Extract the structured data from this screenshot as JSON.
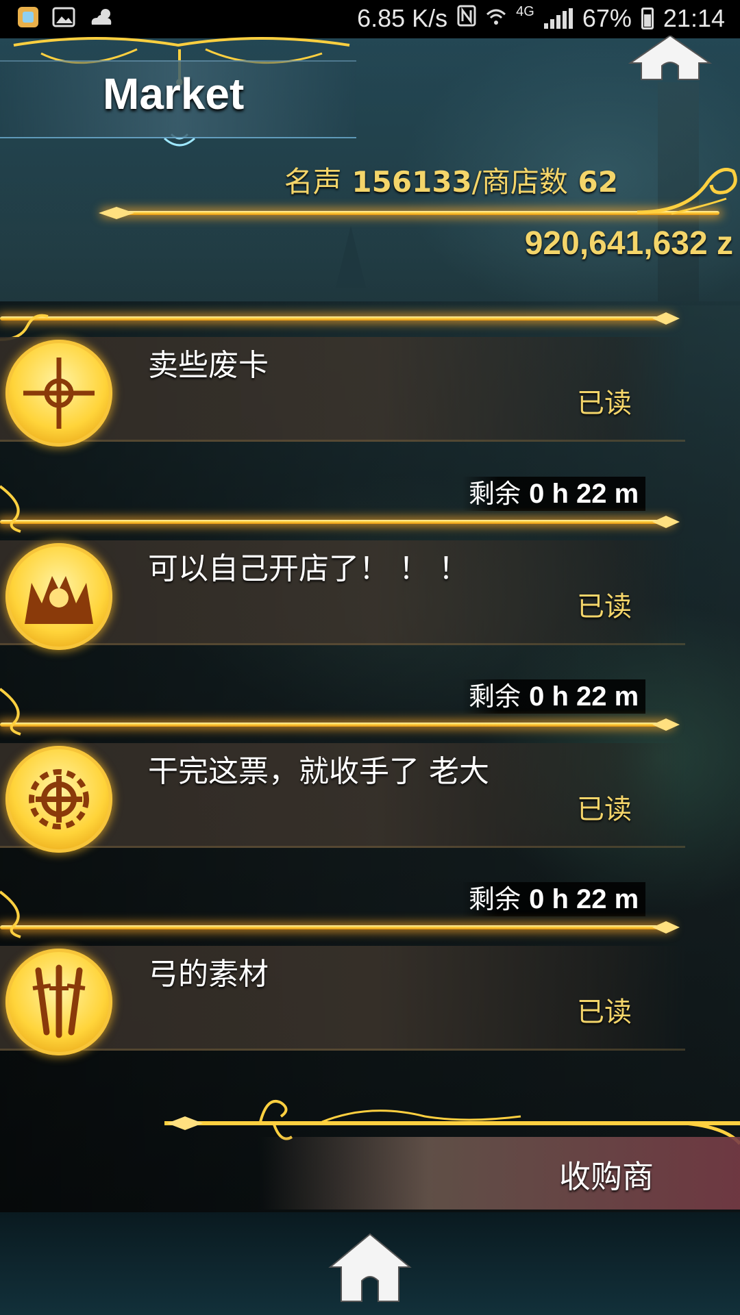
{
  "status_bar": {
    "net_speed": "6.85 K/s",
    "network_type": "4G",
    "battery": "67%",
    "time": "21:14",
    "left_icons": [
      "app-notification-icon",
      "image-icon",
      "weather-icon"
    ],
    "right_icons": [
      "nfc-icon",
      "wifi-icon",
      "signal-icon",
      "battery-icon"
    ]
  },
  "header": {
    "title": "Market",
    "home_icon": "home-icon"
  },
  "stats": {
    "reputation_label": "名声",
    "reputation_value": "156133",
    "shop_count_label": "/商店数",
    "shop_count_value": "62",
    "money": "920,641,632 z"
  },
  "items": [
    {
      "title": "卖些废卡",
      "status": "已读",
      "timer_label": "剩余",
      "timer_value": "0 h 22 m",
      "icon": "cross-emblem-icon"
    },
    {
      "title": "可以自己开店了！ ！ ！",
      "status": "已读",
      "timer_label": "剩余",
      "timer_value": "0 h 22 m",
      "icon": "crown-emblem-icon"
    },
    {
      "title": "干完这票，就收手了 老大",
      "status": "已读",
      "timer_label": "剩余",
      "timer_value": "0 h 22 m",
      "icon": "gear-emblem-icon"
    },
    {
      "title": "弓的素材",
      "status": "已读",
      "icon": "swords-emblem-icon"
    }
  ],
  "footer": {
    "buyer_button_label": "收购商",
    "home_icon": "home-icon"
  },
  "colors": {
    "gold_text": "#f4d56a",
    "gold_line": "#ffd040",
    "background": "#1a2c30"
  }
}
